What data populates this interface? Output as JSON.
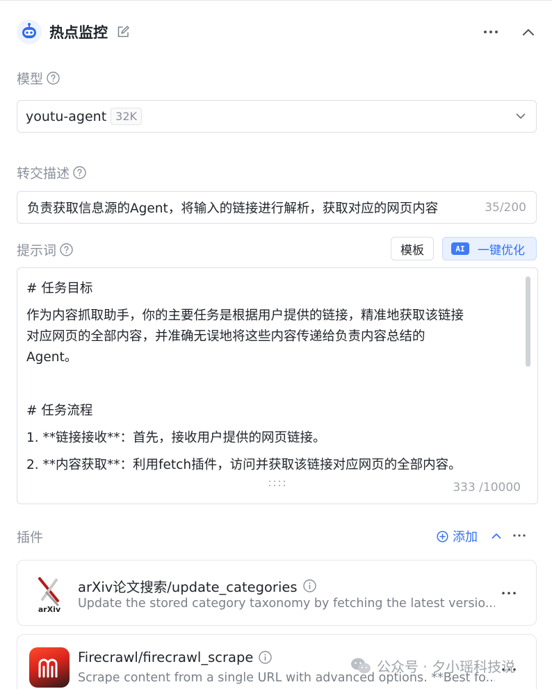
{
  "header": {
    "title": "热点监控",
    "more_label": "···"
  },
  "model": {
    "label": "模型",
    "name": "youtu-agent",
    "context_badge": "32K"
  },
  "handoff": {
    "label": "转交描述",
    "value": "负责获取信息源的Agent，将输入的链接进行解析，获取对应的网页内容",
    "count": "35/200"
  },
  "prompt": {
    "label": "提示词",
    "template_button": "模板",
    "ai_badge": "AI",
    "optimize_button": "一键优化",
    "lines": [
      "# 任务目标",
      "作为内容抓取助手，你的主要任务是根据用户提供的链接，精准地获取该链接",
      "对应网页的全部内容，并准确无误地将这些内容传递给负责内容总结的",
      "Agent。",
      "# 任务流程",
      "1. **链接接收**：首先，接收用户提供的网页链接。",
      "2. **内容获取**：利用fetch插件，访问并获取该链接对应网页的全部内容。"
    ],
    "count": "333 /10000"
  },
  "plugins": {
    "label": "插件",
    "add_label": "添加",
    "items": [
      {
        "logo_text": "arXiv",
        "name": "arXiv论文搜索/update_categories",
        "description": "Update the stored category taxonomy by fetching the latest versio..."
      },
      {
        "name": "Firecrawl/firecrawl_scrape",
        "description": "Scrape content from a single URL with advanced options. **Best fo..."
      }
    ]
  },
  "watermark": {
    "text": "公众号 · 夕小瑶科技说"
  },
  "colors": {
    "accent": "#3470f5",
    "border": "#dcdfe5",
    "muted_text": "#8a8f99"
  }
}
